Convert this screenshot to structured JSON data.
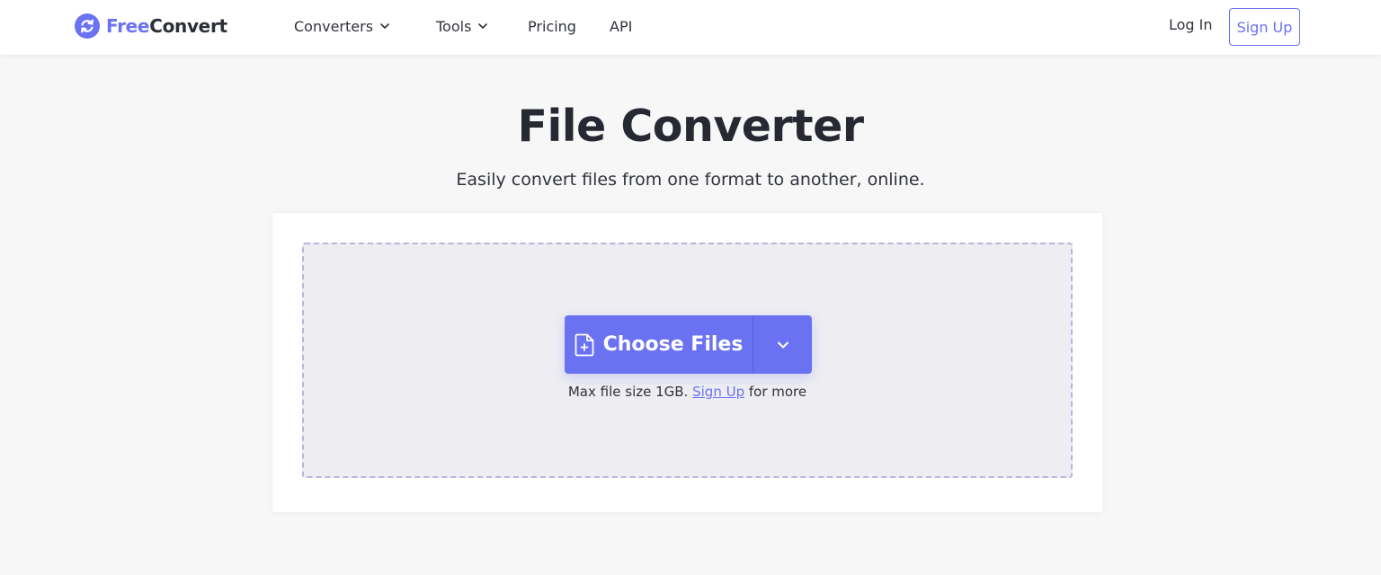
{
  "header": {
    "logo": {
      "free": "Free",
      "convert": "Convert"
    },
    "nav": [
      {
        "label": "Converters",
        "has_dropdown": true
      },
      {
        "label": "Tools",
        "has_dropdown": true
      },
      {
        "label": "Pricing",
        "has_dropdown": false
      },
      {
        "label": "API",
        "has_dropdown": false
      }
    ],
    "login_label": "Log In",
    "signup_label": "Sign Up"
  },
  "hero": {
    "title": "File Converter",
    "subtitle": "Easily convert files from one format to another, online."
  },
  "upload": {
    "choose_label": "Choose Files",
    "choose_icon": "file-add-icon",
    "dropdown_icon": "chevron-down-icon",
    "note_prefix": "Max file size 1GB. ",
    "note_link": "Sign Up",
    "note_suffix": " for more"
  },
  "colors": {
    "accent": "#6b72f2",
    "text": "#282b33",
    "dropzone_bg": "#ededf2",
    "dropzone_border": "#b9b5de",
    "page_bg": "#f7f7f8"
  }
}
